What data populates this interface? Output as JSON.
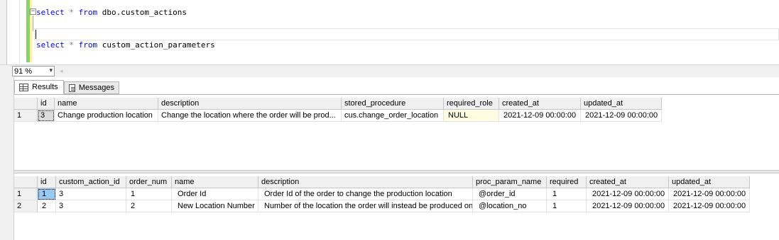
{
  "editor": {
    "line1": {
      "kw1": "select",
      "op": "*",
      "kw2": "from",
      "table": "dbo.custom_actions"
    },
    "line3": {
      "kw1": "select",
      "op": "*",
      "kw2": "from",
      "table": "custom_action_parameters"
    },
    "fold_glyph": "−"
  },
  "zoom": {
    "value": "91 %",
    "arrow": "▾"
  },
  "scroll_left_glyph": "◂",
  "tabs": [
    {
      "label": "Results",
      "icon": "grid-icon"
    },
    {
      "label": "Messages",
      "icon": "messages-icon"
    }
  ],
  "grid1": {
    "columns": [
      "id",
      "name",
      "description",
      "stored_procedure",
      "required_role",
      "created_at",
      "updated_at"
    ],
    "rows": [
      {
        "rownum": "1",
        "cells": [
          "3",
          "Change production location",
          "Change the location where the order will be prod...",
          "cus.change_order_location",
          "NULL",
          "2021-12-09 00:00:00",
          "2021-12-09 00:00:00"
        ]
      }
    ]
  },
  "grid2": {
    "columns": [
      "id",
      "custom_action_id",
      "order_num",
      "name",
      "description",
      "proc_param_name",
      "required",
      "created_at",
      "updated_at"
    ],
    "rows": [
      {
        "rownum": "1",
        "cells": [
          "1",
          "3",
          "1",
          "Order Id",
          "Order Id of the order to change the production location",
          "@order_id",
          "1",
          "2021-12-09 00:00:00",
          "2021-12-09 00:00:00"
        ]
      },
      {
        "rownum": "2",
        "cells": [
          "2",
          "3",
          "2",
          "New Location Number",
          "Number of the location the order will instead be produced on",
          "@location_no",
          "1",
          "2021-12-09 00:00:00",
          "2021-12-09 00:00:00"
        ]
      }
    ]
  }
}
